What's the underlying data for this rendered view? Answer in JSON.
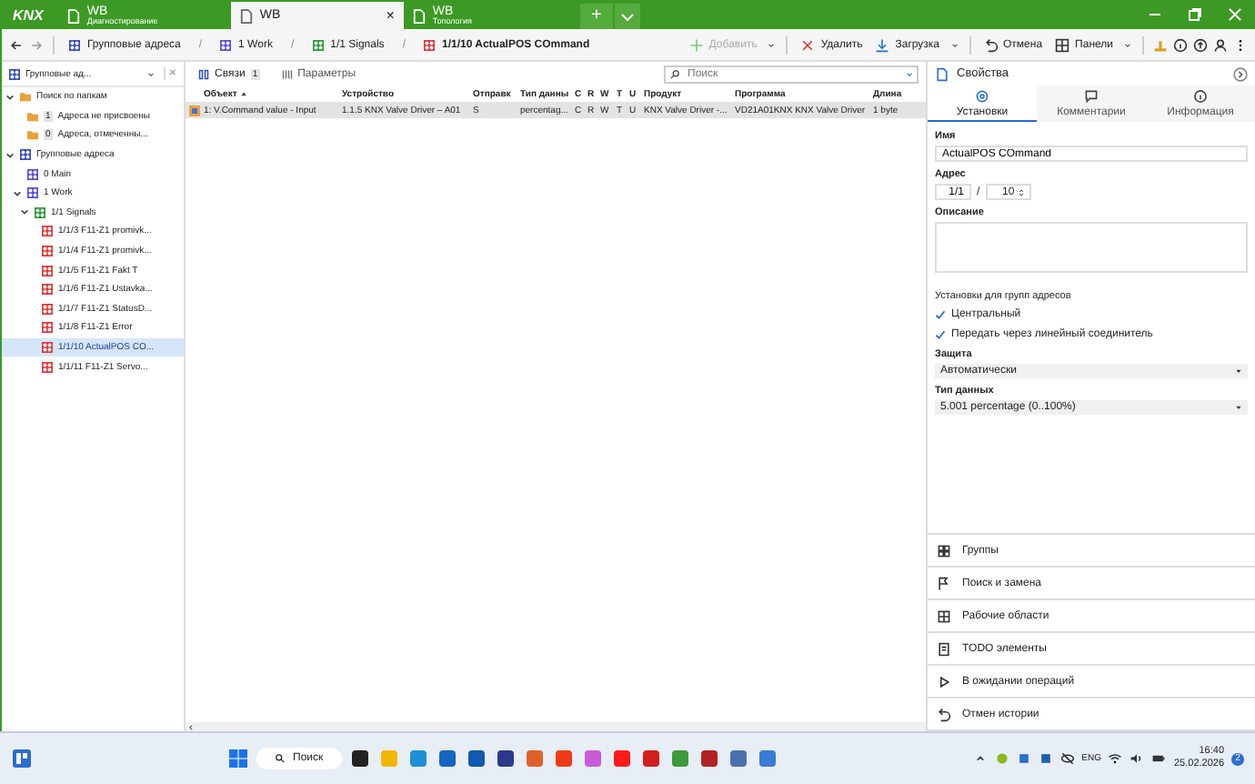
{
  "title_bar": {
    "logo": "KNX",
    "tabs": [
      {
        "title": "WB",
        "subtitle": "Диагностирование",
        "selected": false
      },
      {
        "title": "WB",
        "close": "×",
        "selected": true
      },
      {
        "title": "WB",
        "subtitle": "Топология",
        "selected": false
      }
    ],
    "add": "+"
  },
  "toolbar": {
    "breadcrumbs": [
      {
        "label": "Групповые адреса",
        "kind": "root"
      },
      {
        "label": "1 Work",
        "kind": "main"
      },
      {
        "label": "1/1 Signals",
        "kind": "middle"
      },
      {
        "label": "1/1/10 ActualPOS COmmand",
        "kind": "group"
      }
    ],
    "separator": "/",
    "buttons": [
      {
        "label": "Добавить",
        "kind": "add",
        "disabled": true
      },
      {
        "label": "Удалить",
        "kind": "delete",
        "disabled": false
      },
      {
        "label": "Загрузка",
        "kind": "download",
        "disabled": false
      },
      {
        "label": "Отмена",
        "kind": "undo",
        "disabled": false
      },
      {
        "label": "Панели",
        "kind": "panels",
        "disabled": false
      }
    ]
  },
  "sidebar": {
    "dropdown": "Групповые ад...",
    "close": "×",
    "tree": [
      {
        "label": "Поиск по папкам",
        "kind": "folder",
        "expanded": true,
        "selected": false,
        "children": [
          {
            "label": "Адреса не присвоены",
            "badge": "1",
            "kind": "folder",
            "selected": false
          },
          {
            "label": "Адреса, отмеченны...",
            "badge": "0",
            "kind": "folder",
            "selected": false
          }
        ]
      },
      {
        "label": "Групповые адреса",
        "kind": "root",
        "expanded": true,
        "selected": false,
        "children": [
          {
            "label": "0 Main",
            "kind": "main",
            "selected": false
          },
          {
            "label": "1 Work",
            "kind": "main",
            "expanded": true,
            "selected": false,
            "children": [
              {
                "label": "1/1 Signals",
                "kind": "middle",
                "expanded": true,
                "selected": false,
                "children": [
                  {
                    "label": "1/1/3 F11-Z1 promivk...",
                    "kind": "group",
                    "selected": false
                  },
                  {
                    "label": "1/1/4 F11-Z1 promivk...",
                    "kind": "group",
                    "selected": false
                  },
                  {
                    "label": "1/1/5 F11-Z1 Fakt T",
                    "kind": "group",
                    "selected": false
                  },
                  {
                    "label": "1/1/6 F11-Z1 Ustavka...",
                    "kind": "group",
                    "selected": false
                  },
                  {
                    "label": "1/1/7 F11-Z1  StatusD...",
                    "kind": "group",
                    "selected": false
                  },
                  {
                    "label": "1/1/8 F11-Z1 Error",
                    "kind": "group",
                    "selected": false
                  },
                  {
                    "label": "1/1/10 ActualPOS CO...",
                    "kind": "group",
                    "selected": true
                  },
                  {
                    "label": "1/1/11 F11-Z1  Servo...",
                    "kind": "group",
                    "selected": false
                  }
                ]
              }
            ]
          }
        ]
      }
    ]
  },
  "content": {
    "tabs": [
      {
        "label": "Связи",
        "badge": "1",
        "selected": true
      },
      {
        "label": "Параметры",
        "selected": false
      }
    ],
    "search": {
      "placeholder": "Поиск"
    },
    "table": {
      "columns": [
        {
          "label": "Объект",
          "sorted": true
        },
        {
          "label": "Устройство",
          "sorted": false
        },
        {
          "label": "Отправк",
          "sorted": false
        },
        {
          "label": "Тип данны",
          "sorted": false
        },
        {
          "label": "C",
          "sorted": false
        },
        {
          "label": "R",
          "sorted": false
        },
        {
          "label": "W",
          "sorted": false
        },
        {
          "label": "T",
          "sorted": false
        },
        {
          "label": "U",
          "sorted": false
        },
        {
          "label": "Продукт",
          "sorted": false
        },
        {
          "label": "Программа",
          "sorted": false
        },
        {
          "label": "Длина",
          "sorted": false
        }
      ],
      "rows": [
        {
          "selected": true,
          "cells": [
            "1: V.Command value - Input",
            "1.1.5 KNX Valve Driver – A01",
            "S",
            "percentag...",
            "C",
            "R",
            "W",
            "T",
            "U",
            "KNX Valve Driver -...",
            "VD21A01KNX KNX Valve Driver",
            "1 byte"
          ]
        }
      ]
    }
  },
  "properties": {
    "title": "Свойства",
    "tabs": [
      {
        "label": "Установки",
        "kind": "settings",
        "selected": true
      },
      {
        "label": "Комментарии",
        "kind": "comment",
        "selected": false
      },
      {
        "label": "Информация",
        "kind": "info",
        "selected": false
      }
    ],
    "name_label": "Имя",
    "name": "ActualPOS COmmand",
    "address_label": "Адрес",
    "address_main": "1/1",
    "address_sep": "/",
    "address_sub": "10",
    "description_label": "Описание",
    "group_settings_label": "Установки для групп адресов",
    "checkboxes": [
      {
        "label": "Центральный",
        "checked": true
      },
      {
        "label": "Передать через линейный соединитель",
        "checked": true
      }
    ],
    "protection_label": "Защита",
    "protection": "Автоматически",
    "datatype_label": "Тип данных",
    "datatype": "5.001 percentage (0..100%)"
  },
  "panels": [
    {
      "label": "Группы",
      "kind": "groups"
    },
    {
      "label": "Поиск и замена",
      "kind": "search"
    },
    {
      "label": "Рабочие области",
      "kind": "workspaces"
    },
    {
      "label": "TODO элементы",
      "kind": "todo"
    },
    {
      "label": "В ожидании операций",
      "kind": "pending"
    },
    {
      "label": "Отмен истории",
      "kind": "history"
    }
  ],
  "taskbar": {
    "search": "Поиск",
    "apps": [
      {
        "color": "#222222"
      },
      {
        "color": "#f2b705"
      },
      {
        "color": "#1d8fd6"
      },
      {
        "color": "#1565c0"
      },
      {
        "color": "#0f5ab0"
      },
      {
        "color": "#2b3a8c"
      },
      {
        "color": "#e0602a"
      },
      {
        "color": "#f03a17"
      },
      {
        "color": "#c85bd8"
      },
      {
        "color": "#ff1a1a"
      },
      {
        "color": "#d41e1e"
      },
      {
        "color": "#3c9a3c"
      },
      {
        "color": "#b22222"
      },
      {
        "color": "#4a6fb0"
      },
      {
        "color": "#3a7bd5"
      }
    ],
    "language": "ENG",
    "time": "16:40",
    "date": "25.02.2026",
    "notifications": "2"
  }
}
